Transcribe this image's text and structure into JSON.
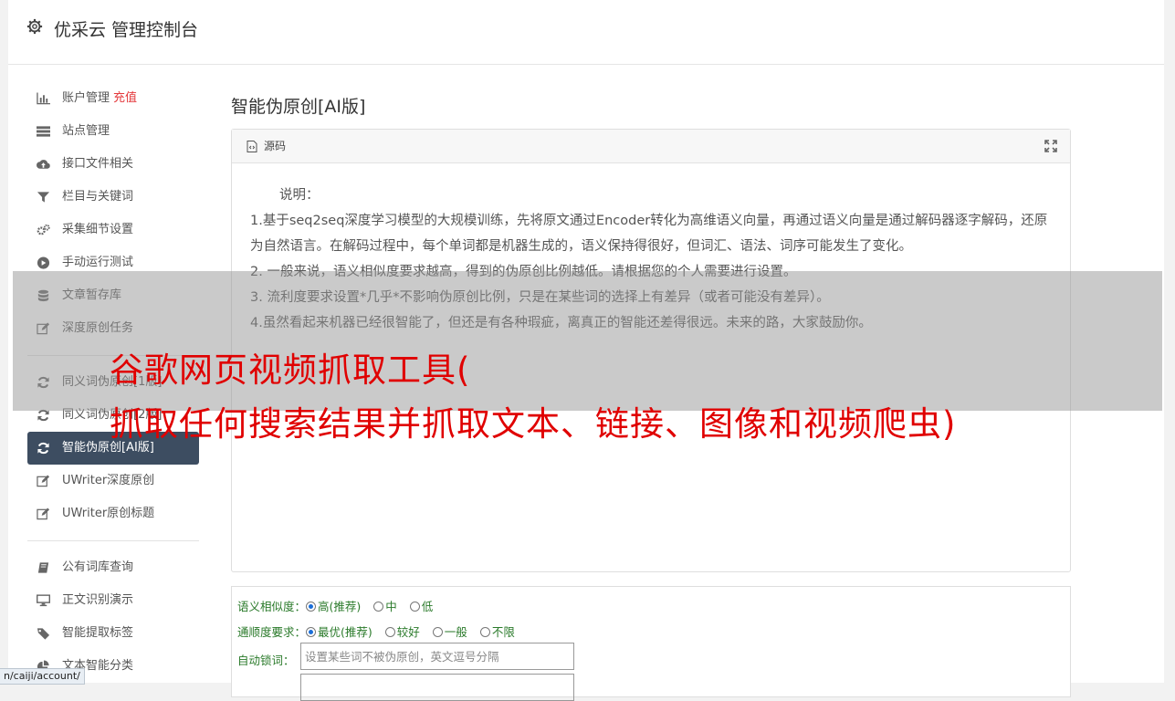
{
  "header": {
    "title": "优采云 管理控制台",
    "icon": "gear-icon"
  },
  "sidebar": {
    "group1": [
      {
        "label": "账户管理",
        "badge": "充值",
        "icon": "bar-chart-icon"
      },
      {
        "label": "站点管理",
        "icon": "list-icon"
      },
      {
        "label": "接口文件相关",
        "icon": "cloud-upload-icon"
      },
      {
        "label": "栏目与关键词",
        "icon": "filter-icon"
      },
      {
        "label": "采集细节设置",
        "icon": "gears-icon"
      },
      {
        "label": "手动运行测试",
        "icon": "play-icon"
      },
      {
        "label": "文章暂存库",
        "icon": "database-icon"
      },
      {
        "label": "深度原创任务",
        "icon": "edit-icon"
      }
    ],
    "group2": [
      {
        "label": "同义词伪原创[1版]",
        "icon": "refresh-icon"
      },
      {
        "label": "同义词伪原创[2版]",
        "icon": "refresh-icon"
      },
      {
        "label": "智能伪原创[AI版]",
        "icon": "refresh-icon",
        "active": true
      },
      {
        "label": "UWriter深度原创",
        "icon": "edit-icon"
      },
      {
        "label": "UWriter原创标题",
        "icon": "edit-icon"
      }
    ],
    "group3": [
      {
        "label": "公有词库查询",
        "icon": "book-icon"
      },
      {
        "label": "正文识别演示",
        "icon": "monitor-icon"
      },
      {
        "label": "智能提取标签",
        "icon": "tag-icon"
      },
      {
        "label": "文本智能分类",
        "icon": "pie-icon"
      }
    ]
  },
  "main": {
    "heading": "智能伪原创[AI版]",
    "panel_label": "源码",
    "desc_title": "说明：",
    "lines": [
      "1.基于seq2seq深度学习模型的大规模训练，先将原文通过Encoder转化为高维语义向量，再通过语义向量是通过解码器逐字解码，还原为自然语言。在解码过程中，每个单词都是机器生成的，语义保持得很好，但词汇、语法、词序可能发生了变化。",
      "2. 一般来说，语义相似度要求越高，得到的伪原创比例越低。请根据您的个人需要进行设置。",
      "3. 流利度要求设置*几乎*不影响伪原创比例，只是在某些词的选择上有差异（或者可能没有差异）。",
      "4.虽然看起来机器已经很智能了，但还是有各种瑕疵，离真正的智能还差得很远。未来的路，大家鼓励你。"
    ]
  },
  "form": {
    "similarity": {
      "label": "语义相似度：",
      "options": [
        "高(推荐)",
        "中",
        "低"
      ],
      "selected": "高(推荐)"
    },
    "fluency": {
      "label": "通顺度要求：",
      "options": [
        "最优(推荐)",
        "较好",
        "一般",
        "不限"
      ],
      "selected": "最优(推荐)"
    },
    "lock": {
      "label": "自动锁词：",
      "placeholder": "设置某些词不被伪原创，英文逗号分隔"
    }
  },
  "overlay": {
    "line1": "谷歌网页视频抓取工具(",
    "line2": "抓取任何搜索结果并抓取文本、链接、图像和视频爬虫)"
  },
  "statusbar": {
    "url": "n/caiji/account/"
  }
}
